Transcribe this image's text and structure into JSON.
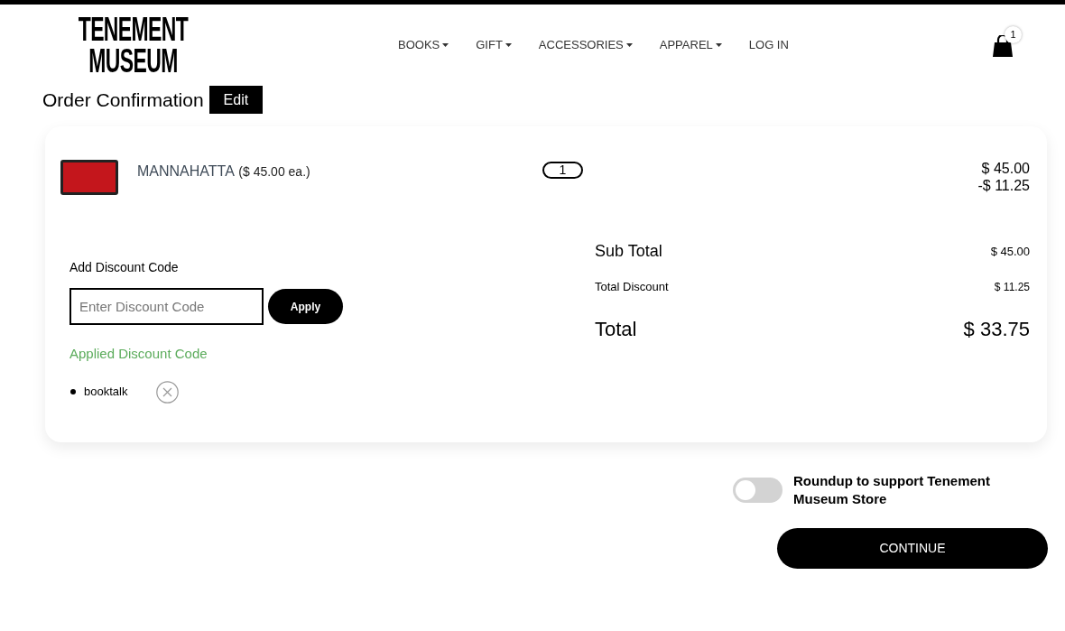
{
  "logo": {
    "lines": [
      "TENEMENT",
      "MUSEUM"
    ]
  },
  "nav": [
    {
      "label": "BOOKS",
      "has_dropdown": true
    },
    {
      "label": "GIFT",
      "has_dropdown": true
    },
    {
      "label": "ACCESSORIES",
      "has_dropdown": true
    },
    {
      "label": "APPAREL",
      "has_dropdown": true
    },
    {
      "label": "LOG IN",
      "has_dropdown": false
    }
  ],
  "cart": {
    "count": "1"
  },
  "page": {
    "title": "Order Confirmation",
    "edit_button": "Edit"
  },
  "items": [
    {
      "name": "MANNAHATTA",
      "unit_price": "($ 45.00 ea.)",
      "quantity": "1",
      "price": "$ 45.00",
      "discount": "-$ 11.25"
    }
  ],
  "discount": {
    "label": "Add Discount Code",
    "placeholder": "Enter Discount Code",
    "button": "Apply",
    "applied_heading": "Applied Discount Code",
    "applied_codes": [
      "booktalk"
    ]
  },
  "summary": [
    {
      "kind": "subtotal",
      "label": "Sub Total",
      "value": "$ 45.00"
    },
    {
      "kind": "discount",
      "label": "Total Discount",
      "value": "$ 11.25"
    },
    {
      "kind": "total",
      "label": "Total",
      "value": "$ 33.75"
    }
  ],
  "roundup": {
    "label": "Roundup to support Tenement Museum Store",
    "on": false
  },
  "continue_button": "CONTINUE"
}
